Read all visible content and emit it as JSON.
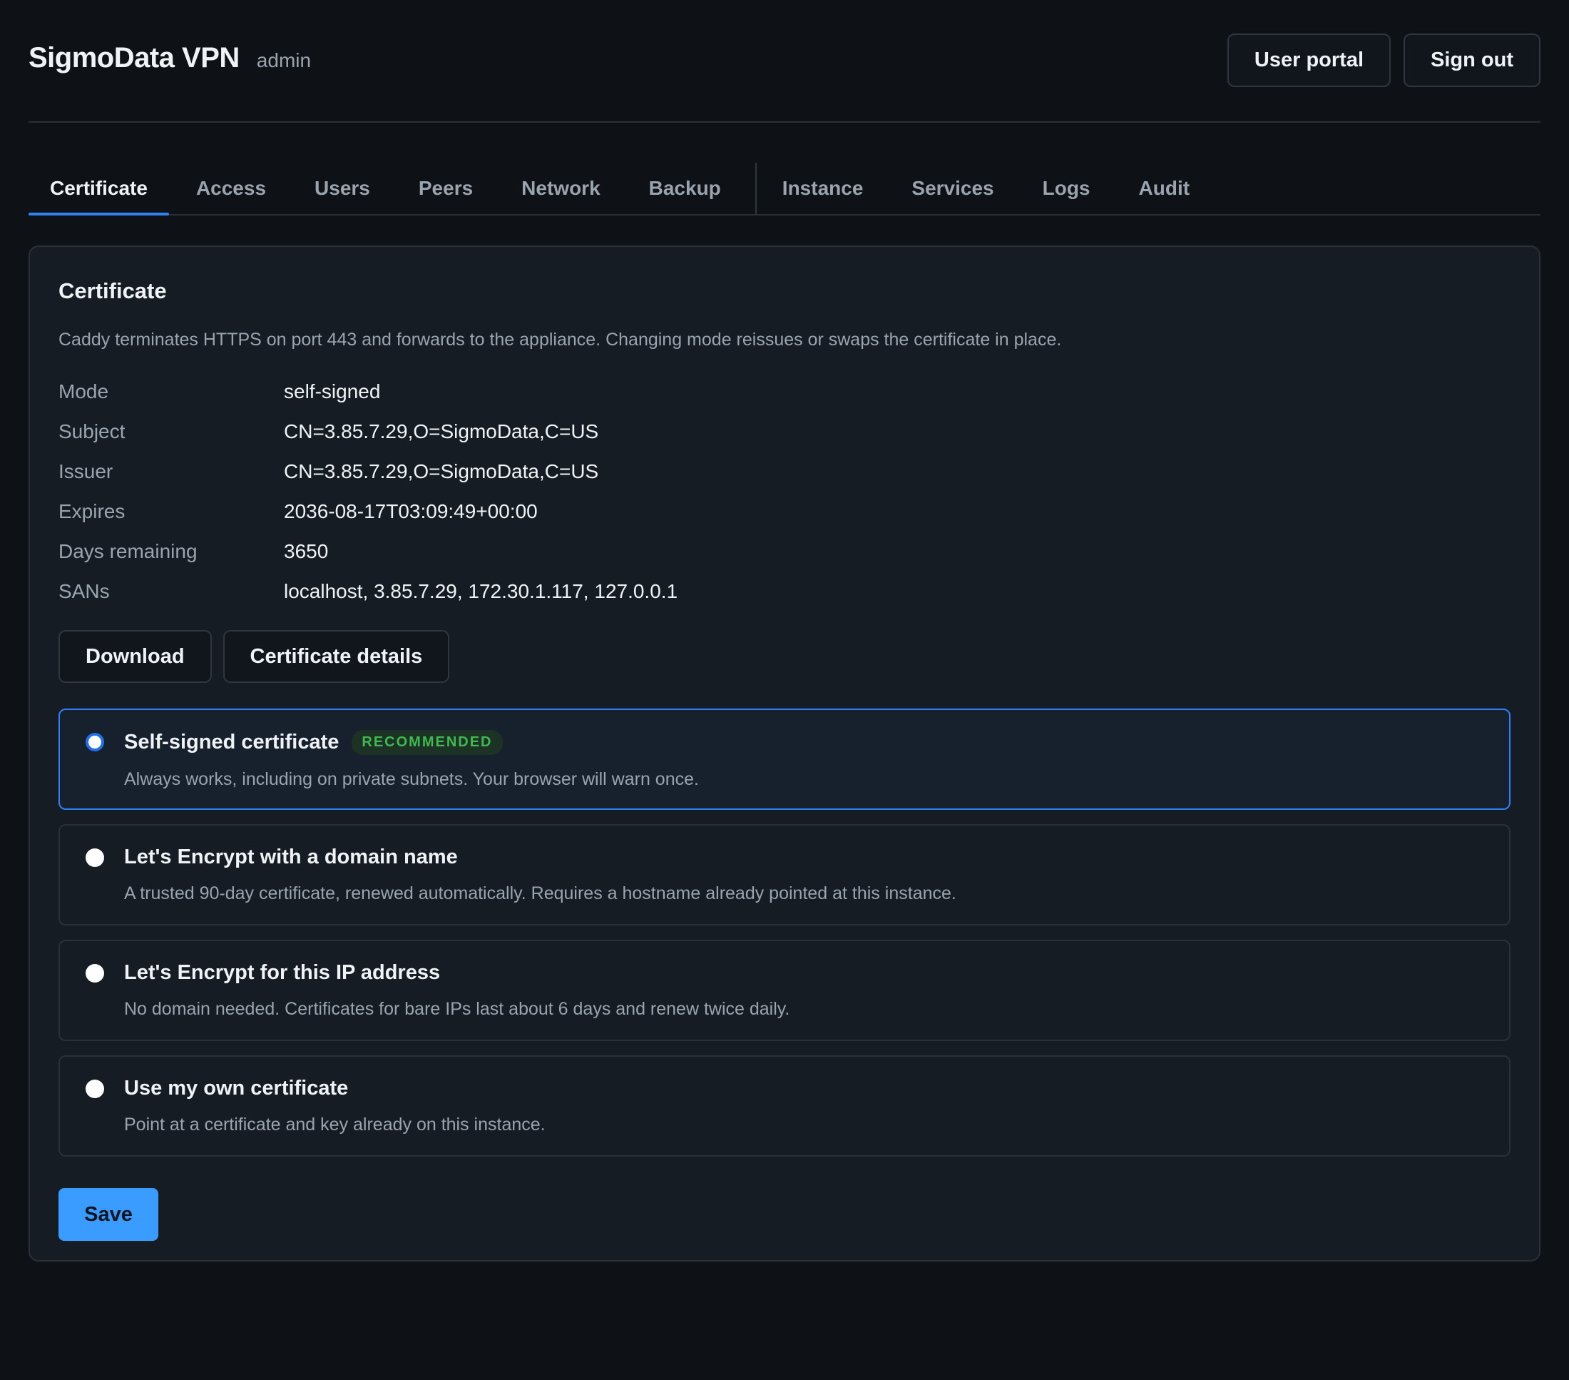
{
  "header": {
    "title": "SigmoData VPN",
    "role": "admin",
    "user_portal_label": "User portal",
    "sign_out_label": "Sign out"
  },
  "tabs": [
    {
      "label": "Certificate",
      "active": true
    },
    {
      "label": "Access"
    },
    {
      "label": "Users"
    },
    {
      "label": "Peers"
    },
    {
      "label": "Network"
    },
    {
      "label": "Backup"
    },
    {
      "label": "Instance"
    },
    {
      "label": "Services"
    },
    {
      "label": "Logs"
    },
    {
      "label": "Audit"
    }
  ],
  "certificate": {
    "title": "Certificate",
    "description": "Caddy terminates HTTPS on port 443 and forwards to the appliance. Changing mode reissues or swaps the certificate in place.",
    "fields": [
      {
        "label": "Mode",
        "value": "self-signed"
      },
      {
        "label": "Subject",
        "value": "CN=3.85.7.29,O=SigmoData,C=US"
      },
      {
        "label": "Issuer",
        "value": "CN=3.85.7.29,O=SigmoData,C=US"
      },
      {
        "label": "Expires",
        "value": "2036-08-17T03:09:49+00:00"
      },
      {
        "label": "Days remaining",
        "value": "3650"
      },
      {
        "label": "SANs",
        "value": "localhost, 3.85.7.29, 172.30.1.117, 127.0.0.1"
      }
    ],
    "download_label": "Download",
    "details_label": "Certificate details",
    "options": [
      {
        "title": "Self-signed certificate",
        "badge": "RECOMMENDED",
        "description": "Always works, including on private subnets. Your browser will warn once.",
        "selected": true
      },
      {
        "title": "Let's Encrypt with a domain name",
        "description": "A trusted 90-day certificate, renewed automatically. Requires a hostname already pointed at this instance."
      },
      {
        "title": "Let's Encrypt for this IP address",
        "description": "No domain needed. Certificates for bare IPs last about 6 days and renew twice daily."
      },
      {
        "title": "Use my own certificate",
        "description": "Point at a certificate and key already on this instance."
      }
    ],
    "save_label": "Save"
  },
  "colors": {
    "background": "#0e1217",
    "card": "#161c23",
    "accent": "#2f81f7",
    "save_button": "#3b9cff",
    "badge_green": "#3fb950"
  }
}
